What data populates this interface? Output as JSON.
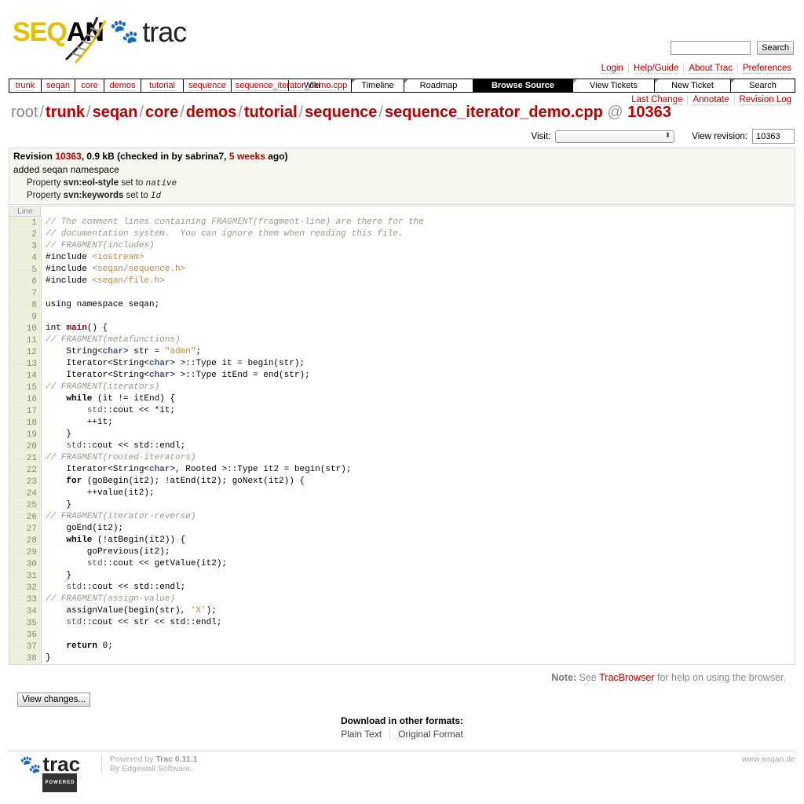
{
  "logo": {
    "text_a": "SEQ",
    "text_b": "AN",
    "trac": "trac"
  },
  "search": {
    "button": "Search"
  },
  "metanav": [
    "Login",
    "Help/Guide",
    "About Trac",
    "Preferences"
  ],
  "mainnav": {
    "breadcrumb": [
      "trunk",
      "seqan",
      "core",
      "demos",
      "tutorial",
      "sequence",
      "sequence_iterator_demo.cpp"
    ],
    "overlap_label": "Wiki",
    "items": [
      "Timeline",
      "Roadmap",
      "Browse Source",
      "View Tickets",
      "New Ticket",
      "Search"
    ],
    "active": "Browse Source"
  },
  "ctxtnav": [
    "Last Change",
    "Annotate",
    "Revision Log"
  ],
  "path": {
    "root": "root",
    "parts": [
      "trunk",
      "seqan",
      "core",
      "demos",
      "tutorial",
      "sequence",
      "sequence_iterator_demo.cpp"
    ],
    "at": "@",
    "rev": "10363"
  },
  "jumprev": {
    "visit_label": "Visit:",
    "view_label": "View revision:",
    "value": "10363"
  },
  "info": {
    "rev_prefix": "Revision",
    "rev": "10363",
    "size": ", 0.9 kB (checked in by sabrina7,",
    "age": "5 weeks",
    "age_suffix": "ago)",
    "message": "added seqan namespace",
    "props": [
      {
        "pre": "Property",
        "name": "svn:eol-style",
        "mid": "set to",
        "val": "native"
      },
      {
        "pre": "Property",
        "name": "svn:keywords",
        "mid": "set to",
        "val": "Id"
      }
    ]
  },
  "code": {
    "header": "Line",
    "lines": [
      "<span class='cm'>// The comment lines containing FRAGMENT(fragment-line) are there for the</span>",
      "<span class='cm'>// documentation system.  You can ignore them when reading this file.</span>",
      "<span class='cm'>// FRAGMENT(includes)</span>",
      "<span class='pp'>#include</span> <span class='st'>&lt;iostream&gt;</span>",
      "<span class='pp'>#include</span> <span class='st'>&lt;seqan/sequence.h&gt;</span>",
      "<span class='pp'>#include</span> <span class='st'>&lt;seqan/file.h&gt;</span>",
      "",
      "using namespace seqan;",
      "",
      "<span class='ty'>int</span> <span class='fn'>main</span>() {",
      "<span class='cm'>// FRAGMENT(metafunctions)</span>",
      "    String&lt;<span class='ty'>char</span>&gt; str = <span class='st'>\"admn\"</span>;",
      "    Iterator&lt;String&lt;<span class='ty'>char</span>&gt; &gt;::Type it = begin(str);",
      "    Iterator&lt;String&lt;<span class='ty'>char</span>&gt; &gt;::Type itEnd = end(str);",
      "<span class='cm'>// FRAGMENT(iterators)</span>",
      "    <span class='kw'>while</span> (it != itEnd) {",
      "        <span class='ns'>std</span>::cout &lt;&lt; *it;",
      "        ++it;",
      "    }",
      "    <span class='ns'>std</span>::cout &lt;&lt; std::endl;",
      "<span class='cm'>// FRAGMENT(rooted-iterators)</span>",
      "    Iterator&lt;String&lt;<span class='ty'>char</span>&gt;, Rooted &gt;::Type it2 = begin(str);",
      "    <span class='kw'>for</span> (goBegin(it2); !atEnd(it2); goNext(it2)) {",
      "        ++value(it2);",
      "    }",
      "<span class='cm'>// FRAGMENT(iterator-reverse)</span>",
      "    goEnd(it2);",
      "    <span class='kw'>while</span> (!atBegin(it2)) {",
      "        goPrevious(it2);",
      "        <span class='ns'>std</span>::cout &lt;&lt; getValue(it2);",
      "    }",
      "    <span class='ns'>std</span>::cout &lt;&lt; std::endl;",
      "<span class='cm'>// FRAGMENT(assign-value)</span>",
      "    assignValue(begin(str), <span class='st'>'X'</span>);",
      "    <span class='ns'>std</span>::cout &lt;&lt; str &lt;&lt; std::endl;",
      "",
      "    <span class='kw'>return</span> 0;",
      "}"
    ]
  },
  "note": {
    "label": "Note:",
    "pre": "See",
    "link": "TracBrowser",
    "post": "for help on using the browser."
  },
  "view_changes": "View changes...",
  "download": {
    "title": "Download in other formats:",
    "formats": [
      "Plain Text",
      "Original Format"
    ]
  },
  "footer": {
    "trac": "trac",
    "powered": "POWERED",
    "pb_pre": "Powered by",
    "pb_link": "Trac 0.11.1",
    "by_pre": "By",
    "by_link": "Edgewall Software",
    "site": "www.seqan.de"
  }
}
